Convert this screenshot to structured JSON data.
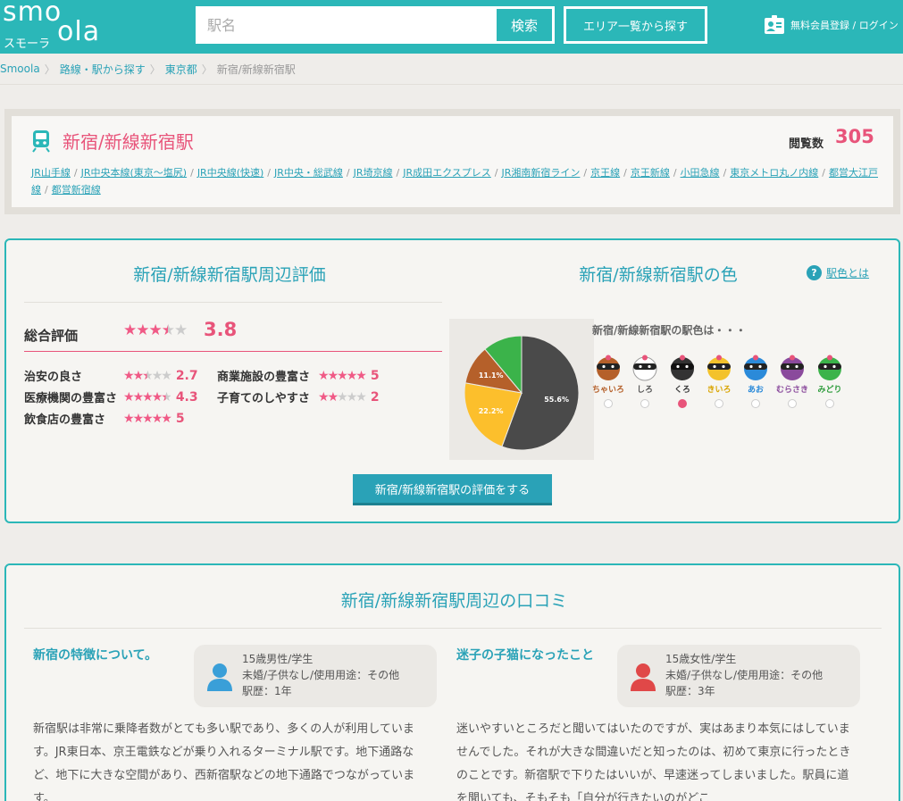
{
  "header": {
    "logo_smo": "smo",
    "logo_ola": "ola",
    "logo_kana": "スモーラ",
    "search_placeholder": "駅名",
    "search_button": "検索",
    "area_button": "エリア一覧から探す",
    "member_link": "無料会員登録 / ログイン",
    "colors": {
      "primary": "#2bb7b8"
    }
  },
  "breadcrumb": {
    "items": [
      "Smoola",
      "路線・駅から探す",
      "東京都"
    ],
    "current": "新宿/新線新宿駅"
  },
  "station": {
    "name": "新宿/新線新宿駅",
    "views_label": "閲覧数",
    "views": "305",
    "lines": [
      "JR山手線",
      "JR中央本線(東京～塩尻)",
      "JR中央線(快速)",
      "JR中央・総武線",
      "JR埼京線",
      "JR成田エクスプレス",
      "JR湘南新宿ライン",
      "京王線",
      "京王新線",
      "小田急線",
      "東京メトロ丸ノ内線",
      "都営大江戸線",
      "都営新宿線"
    ]
  },
  "evaluation": {
    "title": "新宿/新線新宿駅周辺評価",
    "overall_label": "総合評価",
    "overall_score": "3.8",
    "overall_stars": 3.8,
    "ratings": [
      {
        "label": "治安の良さ",
        "score": "2.7",
        "stars": 2.7
      },
      {
        "label": "商業施設の豊富さ",
        "score": "5",
        "stars": 5
      },
      {
        "label": "医療機関の豊富さ",
        "score": "4.3",
        "stars": 4.3
      },
      {
        "label": "子育てのしやすさ",
        "score": "2",
        "stars": 2
      },
      {
        "label": "飲食店の豊富さ",
        "score": "5",
        "stars": 5
      }
    ],
    "button": "新宿/新線新宿駅の評価をする"
  },
  "station_color": {
    "title": "新宿/新線新宿駅の色",
    "help_label": "駅色とは",
    "question": "新宿/新線新宿駅の駅色は・・・",
    "characters": [
      {
        "name": "ちゃいろ",
        "color": "#b5602a",
        "name_color": "#b5602a"
      },
      {
        "name": "しろ",
        "color": "#ffffff",
        "name_color": "#555555"
      },
      {
        "name": "くろ",
        "color": "#333333",
        "name_color": "#333333"
      },
      {
        "name": "きいろ",
        "color": "#f3c22b",
        "name_color": "#d9a400"
      },
      {
        "name": "あお",
        "color": "#2b8ad9",
        "name_color": "#2b8ad9"
      },
      {
        "name": "むらさき",
        "color": "#8a4a9c",
        "name_color": "#8a4a9c"
      },
      {
        "name": "みどり",
        "color": "#3bb34a",
        "name_color": "#2e9c3c"
      }
    ],
    "selected_index": 2
  },
  "chart_data": {
    "type": "pie",
    "values": [
      55.6,
      22.2,
      11.1,
      11.1
    ],
    "labels": [
      "55.6%",
      "22.2%",
      "11.1%",
      ""
    ],
    "colors": [
      "#4a4a4a",
      "#fcbf2c",
      "#b5602a",
      "#3bb34a"
    ],
    "slice_order": [
      "くろ",
      "きいろ",
      "ちゃいろ",
      "みどり"
    ]
  },
  "reviews": {
    "title": "新宿/新線新宿駅周辺の口コミ",
    "items": [
      {
        "heading": "新宿の特徴について。",
        "user_line1": "15歳男性/学生",
        "user_line2": "未婚/子供なし/使用用途：その他",
        "user_line3": "駅歴：1年",
        "avatar_color": "#3a9fd8",
        "body": "新宿駅は非常に乗降者数がとても多い駅であり、多くの人が利用しています。JR東日本、京王電鉄などが乗り入れるターミナル駅です。地下通路など、地下に大きな空間があり、西新宿駅などの地下通路でつながっています。"
      },
      {
        "heading": "迷子の子猫になったこと",
        "user_line1": "15歳女性/学生",
        "user_line2": "未婚/子供なし/使用用途：その他",
        "user_line3": "駅歴：3年",
        "avatar_color": "#e04848",
        "body": "迷いやすいところだと聞いてはいたのですが、実はあまり本気にはしていませんでした。それが大きな間違いだと知ったのは、初めて東京に行ったときのことです。新宿駅で下りたはいいが、早速迷ってしまいました。駅員に道を聞いても、そもそも「自分が行きたいのがどこ"
      }
    ]
  }
}
